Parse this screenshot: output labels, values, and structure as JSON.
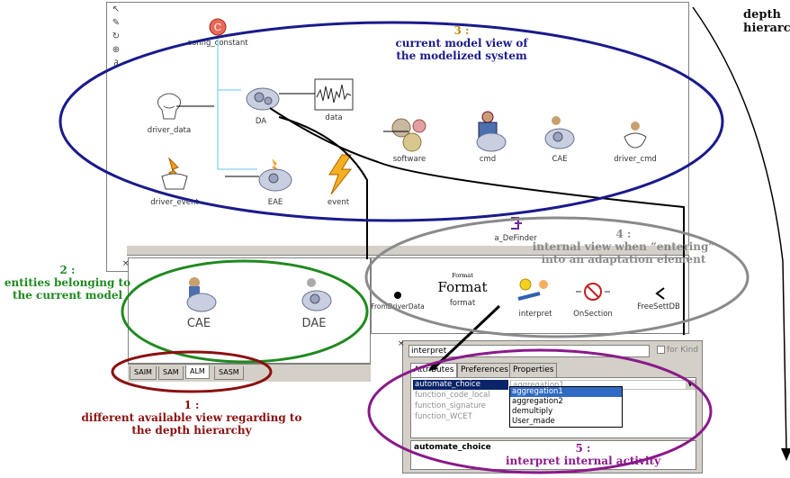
{
  "header": {
    "depth_label": "depth\nhierarchy"
  },
  "main_view": {
    "nodes": [
      {
        "label": "config_constant",
        "icon": "constant-icon"
      },
      {
        "label": "driver_data",
        "icon": "driver-data-icon"
      },
      {
        "label": "DA",
        "icon": "gear-icon"
      },
      {
        "label": "data",
        "icon": "waveform-icon"
      },
      {
        "label": "software",
        "icon": "gears-icon"
      },
      {
        "label": "cmd",
        "icon": "person-gear-icon"
      },
      {
        "label": "CAE",
        "icon": "gear-icon"
      },
      {
        "label": "driver_cmd",
        "icon": "driver-cmd-icon"
      },
      {
        "label": "driver_event",
        "icon": "driver-event-icon"
      },
      {
        "label": "EAE",
        "icon": "gear-icon"
      },
      {
        "label": "event",
        "icon": "lightning-icon"
      }
    ]
  },
  "entities": {
    "items": [
      {
        "label": "CAE"
      },
      {
        "label": "DAE"
      }
    ]
  },
  "view_tabs": [
    "SAIM",
    "SAM",
    "ALM",
    "SASM"
  ],
  "adaptation_view": {
    "top_item": "a_DeFinder",
    "items": [
      {
        "label": "FromDriverData"
      },
      {
        "label": "format",
        "big": "Format",
        "small": "Format"
      },
      {
        "label": "interpret"
      },
      {
        "label": "OnSection"
      },
      {
        "label": "FreeSettDB"
      }
    ]
  },
  "properties": {
    "search_value": "interpret",
    "for_kind_label": "for Kind",
    "tabs": [
      "Attributes",
      "Preferences",
      "Properties"
    ],
    "attributes": [
      {
        "name": "automate_choice",
        "value": "aggregation1"
      },
      {
        "name": "function_code_local",
        "value": ""
      },
      {
        "name": "function_signature",
        "value": ""
      },
      {
        "name": "function_WCET",
        "value": ""
      }
    ],
    "dropdown_options": [
      "aggregation1",
      "aggregation2",
      "demultiply",
      "User_made"
    ],
    "selected_option": "aggregation1",
    "footer_label": "automate_choice"
  },
  "annotations": {
    "a1": {
      "num": "1 :",
      "text": "different available view regarding to\nthe depth hierarchy",
      "color": "#8b1010"
    },
    "a2": {
      "num": "2 :",
      "text": "entities belonging to\nthe current model",
      "color": "#1f8a1f"
    },
    "a3": {
      "num": "3 :",
      "text": "current model view of\nthe modelized system",
      "color": "#1a1a8c"
    },
    "a4": {
      "num": "4 :",
      "text": "internal view when “entering”\ninto an adaptation element",
      "color": "#8a8a8a"
    },
    "a5": {
      "num": "5 :",
      "text": "interpret internal activity",
      "color": "#8a1a8a"
    }
  }
}
